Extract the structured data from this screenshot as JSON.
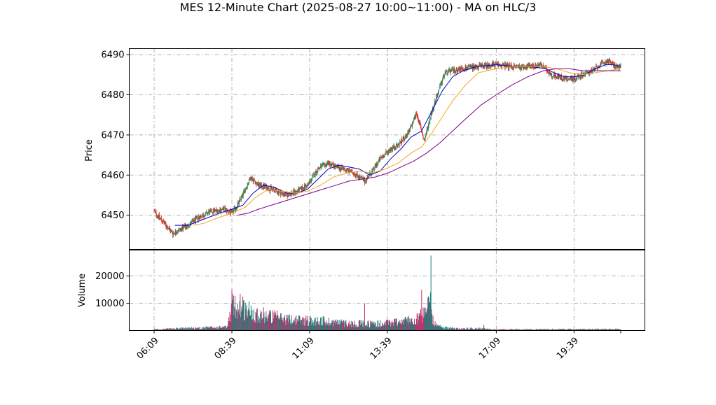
{
  "chart_data": {
    "type": "candlestick",
    "title": "MES 12-Minute Chart (2025-08-27 10:00~11:00) - MA on HLC/3",
    "price_axis": {
      "ylabel": "Price",
      "ticks": [
        6450,
        6460,
        6470,
        6480,
        6490
      ],
      "ylim": [
        6441.5,
        6491.5
      ]
    },
    "volume_axis": {
      "ylabel": "Volume",
      "ticks": [
        10000,
        20000
      ],
      "ylim": [
        0,
        29500
      ]
    },
    "x_axis": {
      "tick_labels": [
        "06:09",
        "08:39",
        "11:09",
        "13:39",
        "17:09",
        "19:39"
      ],
      "tick_times": [
        "06:09",
        "08:39",
        "11:09",
        "13:39",
        "17:09",
        "19:39"
      ],
      "range": [
        "06:09",
        "21:09"
      ],
      "tick_label_rotation_deg": 45
    },
    "grid": true,
    "up_color": "#2e8b57",
    "down_color": "#e03030",
    "price_keypoints": [
      [
        "06:09",
        6451.0
      ],
      [
        "06:25",
        6448.5
      ],
      [
        "06:45",
        6445.5
      ],
      [
        "07:00",
        6446.5
      ],
      [
        "07:15",
        6447.5
      ],
      [
        "07:35",
        6449.5
      ],
      [
        "08:00",
        6451.0
      ],
      [
        "08:25",
        6451.5
      ],
      [
        "08:39",
        6450.5
      ],
      [
        "08:50",
        6452.5
      ],
      [
        "09:05",
        6456.5
      ],
      [
        "09:15",
        6459.5
      ],
      [
        "09:30",
        6457.5
      ],
      [
        "09:45",
        6457.0
      ],
      [
        "10:05",
        6456.0
      ],
      [
        "10:25",
        6455.0
      ],
      [
        "10:45",
        6456.0
      ],
      [
        "11:05",
        6457.5
      ],
      [
        "11:25",
        6461.5
      ],
      [
        "11:45",
        6463.0
      ],
      [
        "12:00",
        6462.0
      ],
      [
        "12:15",
        6461.5
      ],
      [
        "12:35",
        6460.5
      ],
      [
        "12:55",
        6458.5
      ],
      [
        "13:10",
        6461.0
      ],
      [
        "13:25",
        6464.0
      ],
      [
        "13:45",
        6466.5
      ],
      [
        "14:00",
        6467.5
      ],
      [
        "14:20",
        6470.5
      ],
      [
        "14:35",
        6475.5
      ],
      [
        "14:50",
        6468.5
      ],
      [
        "15:05",
        6476.0
      ],
      [
        "15:15",
        6480.0
      ],
      [
        "15:30",
        6485.5
      ],
      [
        "16:00",
        6486.5
      ],
      [
        "16:30",
        6487.0
      ],
      [
        "17:09",
        6487.5
      ],
      [
        "17:40",
        6487.0
      ],
      [
        "18:10",
        6487.0
      ],
      [
        "18:35",
        6487.5
      ],
      [
        "18:55",
        6485.0
      ],
      [
        "19:20",
        6484.0
      ],
      [
        "19:39",
        6484.0
      ],
      [
        "19:55",
        6485.0
      ],
      [
        "20:15",
        6486.0
      ],
      [
        "20:30",
        6487.5
      ],
      [
        "20:45",
        6488.5
      ],
      [
        "21:00",
        6487.0
      ],
      [
        "21:09",
        6487.0
      ]
    ],
    "moving_averages": [
      {
        "color": "#0000cc",
        "points": [
          [
            "06:49",
            6447.5
          ],
          [
            "07:15",
            6447.5
          ],
          [
            "07:45",
            6449.0
          ],
          [
            "08:15",
            6450.5
          ],
          [
            "08:39",
            6451.5
          ],
          [
            "09:00",
            6452.5
          ],
          [
            "09:20",
            6455.5
          ],
          [
            "09:40",
            6457.5
          ],
          [
            "10:00",
            6457.0
          ],
          [
            "10:25",
            6455.5
          ],
          [
            "10:45",
            6455.5
          ],
          [
            "11:05",
            6456.5
          ],
          [
            "11:25",
            6459.0
          ],
          [
            "11:45",
            6461.5
          ],
          [
            "12:05",
            6462.5
          ],
          [
            "12:25",
            6462.0
          ],
          [
            "12:45",
            6461.5
          ],
          [
            "13:05",
            6460.0
          ],
          [
            "13:25",
            6461.0
          ],
          [
            "13:45",
            6464.0
          ],
          [
            "14:05",
            6466.5
          ],
          [
            "14:25",
            6469.5
          ],
          [
            "14:45",
            6471.0
          ],
          [
            "15:05",
            6476.0
          ],
          [
            "15:25",
            6481.0
          ],
          [
            "15:45",
            6484.5
          ],
          [
            "16:05",
            6486.0
          ],
          [
            "16:30",
            6487.0
          ],
          [
            "17:09",
            6487.5
          ],
          [
            "17:45",
            6487.0
          ],
          [
            "18:15",
            6487.0
          ],
          [
            "18:45",
            6486.5
          ],
          [
            "19:00",
            6485.5
          ],
          [
            "19:20",
            6484.5
          ],
          [
            "19:39",
            6484.5
          ],
          [
            "20:00",
            6485.0
          ],
          [
            "20:20",
            6486.5
          ],
          [
            "20:40",
            6487.5
          ],
          [
            "20:55",
            6487.5
          ],
          [
            "21:09",
            6487.0
          ]
        ]
      },
      {
        "color": "#f5a623",
        "points": [
          [
            "07:25",
            6447.5
          ],
          [
            "07:45",
            6448.0
          ],
          [
            "08:15",
            6449.5
          ],
          [
            "08:39",
            6450.5
          ],
          [
            "09:05",
            6452.0
          ],
          [
            "09:25",
            6454.5
          ],
          [
            "09:50",
            6456.5
          ],
          [
            "10:15",
            6456.0
          ],
          [
            "10:40",
            6455.5
          ],
          [
            "11:05",
            6456.0
          ],
          [
            "11:30",
            6457.5
          ],
          [
            "11:55",
            6459.5
          ],
          [
            "12:20",
            6460.5
          ],
          [
            "12:45",
            6461.0
          ],
          [
            "13:10",
            6460.5
          ],
          [
            "13:35",
            6461.5
          ],
          [
            "14:00",
            6463.0
          ],
          [
            "14:25",
            6465.5
          ],
          [
            "14:45",
            6467.0
          ],
          [
            "15:05",
            6470.5
          ],
          [
            "15:25",
            6474.5
          ],
          [
            "15:45",
            6478.5
          ],
          [
            "16:10",
            6482.5
          ],
          [
            "16:35",
            6485.5
          ],
          [
            "17:09",
            6486.5
          ],
          [
            "17:40",
            6487.0
          ],
          [
            "18:10",
            6487.0
          ],
          [
            "18:40",
            6487.0
          ],
          [
            "19:05",
            6486.5
          ],
          [
            "19:30",
            6485.5
          ],
          [
            "19:55",
            6485.0
          ],
          [
            "20:20",
            6485.5
          ],
          [
            "20:45",
            6486.0
          ],
          [
            "21:09",
            6486.5
          ]
        ]
      },
      {
        "color": "#800080",
        "points": [
          [
            "08:49",
            6450.0
          ],
          [
            "09:10",
            6450.5
          ],
          [
            "09:30",
            6451.5
          ],
          [
            "09:55",
            6452.5
          ],
          [
            "10:20",
            6453.5
          ],
          [
            "10:45",
            6454.5
          ],
          [
            "11:10",
            6455.5
          ],
          [
            "11:35",
            6456.5
          ],
          [
            "12:00",
            6457.5
          ],
          [
            "12:25",
            6458.5
          ],
          [
            "12:50",
            6459.0
          ],
          [
            "13:15",
            6459.5
          ],
          [
            "13:40",
            6460.5
          ],
          [
            "14:05",
            6462.0
          ],
          [
            "14:30",
            6463.5
          ],
          [
            "14:55",
            6465.5
          ],
          [
            "15:20",
            6468.0
          ],
          [
            "15:45",
            6471.0
          ],
          [
            "16:10",
            6474.0
          ],
          [
            "16:40",
            6477.5
          ],
          [
            "17:09",
            6480.0
          ],
          [
            "17:40",
            6482.5
          ],
          [
            "18:10",
            6484.5
          ],
          [
            "18:40",
            6486.0
          ],
          [
            "19:05",
            6486.5
          ],
          [
            "19:30",
            6486.5
          ],
          [
            "19:55",
            6486.0
          ],
          [
            "20:20",
            6486.0
          ],
          [
            "20:45",
            6486.0
          ],
          [
            "21:09",
            6486.0
          ]
        ]
      }
    ],
    "volume_keypoints": [
      [
        "06:09",
        400
      ],
      [
        "07:30",
        900
      ],
      [
        "08:30",
        1200
      ],
      [
        "08:40",
        9000
      ],
      [
        "09:00",
        8000
      ],
      [
        "09:30",
        6000
      ],
      [
        "10:30",
        4000
      ],
      [
        "11:30",
        3500
      ],
      [
        "12:30",
        2500
      ],
      [
        "13:30",
        2500
      ],
      [
        "14:30",
        4000
      ],
      [
        "14:55",
        6000
      ],
      [
        "15:00",
        10000
      ],
      [
        "15:05",
        4000
      ],
      [
        "15:15",
        1500
      ],
      [
        "16:00",
        500
      ],
      [
        "16:30",
        900
      ],
      [
        "17:00",
        350
      ],
      [
        "19:00",
        450
      ],
      [
        "21:09",
        450
      ]
    ],
    "volume_spikes": [
      [
        "08:39",
        15000
      ],
      [
        "08:55",
        13500
      ],
      [
        "09:00",
        12500
      ],
      [
        "12:55",
        10000
      ],
      [
        "14:45",
        15000
      ],
      [
        "14:57",
        12000
      ],
      [
        "15:02",
        14000
      ],
      [
        "15:03",
        27500
      ],
      [
        "16:45",
        2000
      ]
    ]
  }
}
